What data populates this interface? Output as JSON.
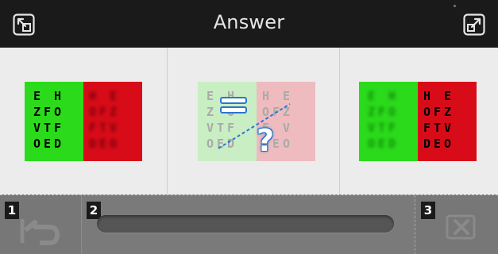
{
  "header": {
    "title": "Answer",
    "left_button_icon": "collapse-arrow-icon",
    "right_button_icon": "expand-arrow-icon"
  },
  "choices": [
    {
      "id": "choice-left",
      "left_rows": [
        [
          "E",
          "",
          "H"
        ],
        [
          "Z",
          "F",
          "O"
        ],
        [
          "V",
          "T",
          "F"
        ],
        [
          "O",
          "E",
          "D"
        ]
      ],
      "right_rows": [
        [
          "H",
          "",
          "E"
        ],
        [
          "O",
          "F",
          "Z"
        ],
        [
          "F",
          "T",
          "V"
        ],
        [
          "D",
          "E",
          "O"
        ]
      ],
      "sharp_side": "green"
    },
    {
      "id": "choice-middle",
      "left_rows": [
        [
          "E",
          "",
          "H"
        ],
        [
          "Z",
          "",
          "O"
        ],
        [
          "V",
          "T",
          "F"
        ],
        [
          "O",
          "E",
          "D"
        ]
      ],
      "right_rows": [
        [
          "H",
          "",
          "E"
        ],
        [
          "O",
          "F",
          "Z"
        ],
        [
          "F",
          "",
          "V"
        ],
        [
          "D",
          "E",
          "O"
        ]
      ],
      "overlay_icons": [
        "equals-icon",
        "question-mark-icon"
      ],
      "question_text": "?"
    },
    {
      "id": "choice-right",
      "left_rows": [
        [
          "E",
          "",
          "H"
        ],
        [
          "Z",
          "F",
          "O"
        ],
        [
          "V",
          "T",
          "F"
        ],
        [
          "O",
          "E",
          "D"
        ]
      ],
      "right_rows": [
        [
          "H",
          "",
          "E"
        ],
        [
          "O",
          "F",
          "Z"
        ],
        [
          "F",
          "T",
          "V"
        ],
        [
          "D",
          "E",
          "O"
        ]
      ],
      "sharp_side": "red"
    }
  ],
  "toolbar": {
    "back": {
      "number": "1",
      "icon": "undo-arrow-icon"
    },
    "slider": {
      "number": "2"
    },
    "clear": {
      "number": "3",
      "icon": "clear-icon"
    }
  },
  "colors": {
    "green": "#2bdb1b",
    "red": "#d80c19",
    "title_bar": "#1a1a1a",
    "toolbar": "#6f6f6f",
    "panel": "#ececec"
  }
}
